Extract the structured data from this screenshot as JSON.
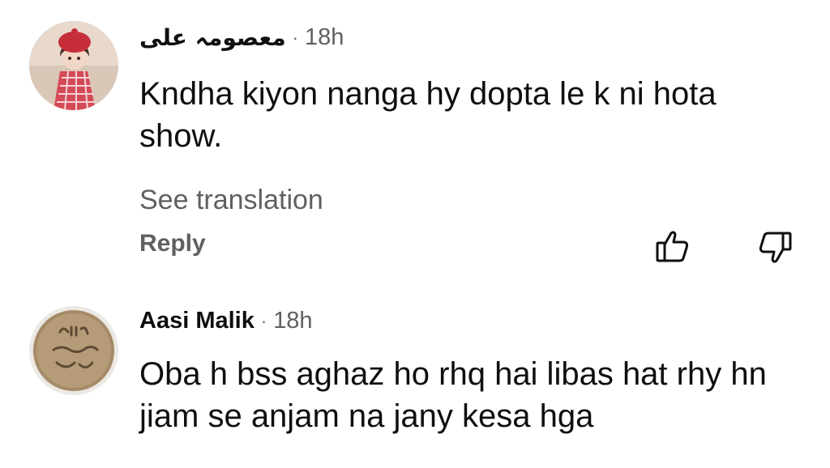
{
  "comments": [
    {
      "author": "معصومہ علی",
      "separator": "·",
      "time": "18h",
      "text": "Kndha kiyon nanga hy dopta le k ni hota show.",
      "see_translation": "See translation",
      "reply": "Reply",
      "avatar": "doll-avatar-icon"
    },
    {
      "author": "Aasi Malik",
      "separator": "·",
      "time": "18h",
      "text": "Oba h bss aghaz ho rhq hai libas hat rhy hn jiam se anjam na jany kesa hga",
      "avatar": "coin-avatar-icon"
    }
  ],
  "icons": {
    "like": "thumbs-up-icon",
    "dislike": "thumbs-down-icon"
  },
  "colors": {
    "text": "#0f0f0f",
    "secondary": "#606060",
    "background": "#ffffff"
  }
}
